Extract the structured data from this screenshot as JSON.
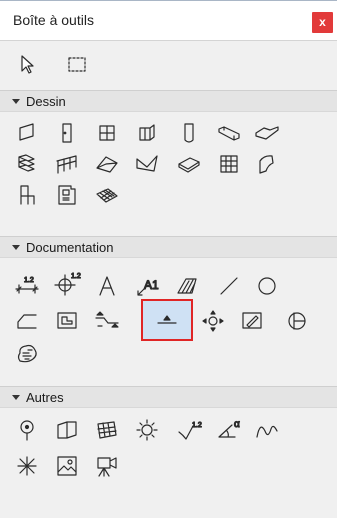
{
  "window": {
    "title": "Boîte à outils",
    "close_label": "x"
  },
  "sections": [
    {
      "label": "Dessin"
    },
    {
      "label": "Documentation"
    },
    {
      "label": "Autres"
    }
  ],
  "tool_labels": {
    "level_dimension": "1.2",
    "angle_dimension": "α",
    "label_text": "A1",
    "coord_dimension": "1.2"
  }
}
